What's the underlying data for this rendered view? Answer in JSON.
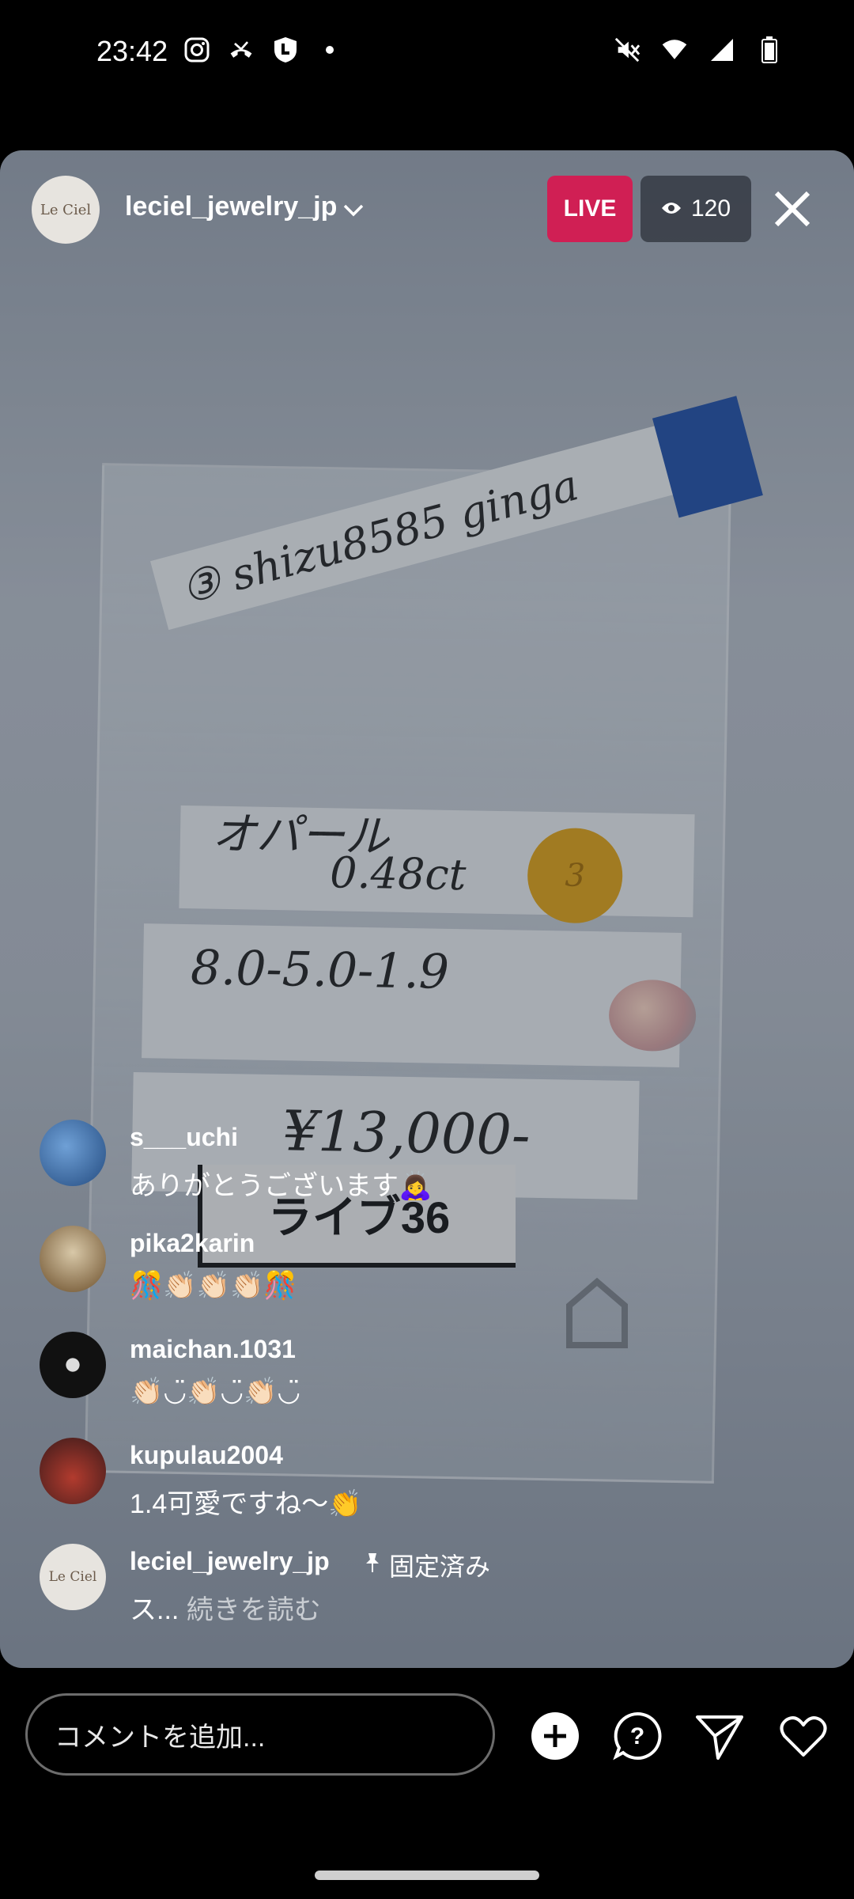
{
  "status_bar": {
    "time": "23:42",
    "left_icons": [
      "instagram-icon",
      "missed-call-icon",
      "shield-lock-icon",
      "dot-icon"
    ],
    "right_icons": [
      "mute-icon",
      "wifi-icon",
      "signal-icon",
      "battery-icon"
    ]
  },
  "live": {
    "host_name": "leciel_jewelry_jp",
    "host_avatar_text": "Le Ciel",
    "live_badge": "LIVE",
    "viewer_count": "120"
  },
  "scene": {
    "tag_text": "③ shizu8585 ginga",
    "label1_text": "オパール",
    "label1_ct": "0.48ct",
    "label1_badge": "3",
    "label2_text": "8.0-5.0-1.9",
    "price_text": "¥13,000-",
    "live_label": "ライブ36"
  },
  "comments": [
    {
      "user": "s___uchi",
      "text": "ありがとうございます🙇‍♀️",
      "avatar_color": "#3b6aa8"
    },
    {
      "user": "pika2karin",
      "text": "🎊👏🏻👏🏻👏🏻🎊",
      "avatar_color": "#8a6a45"
    },
    {
      "user": "maichan.1031",
      "text": "👏🏻◡̈👏🏻◡̈👏🏻◡̈",
      "avatar_color": "#1a1a1a"
    },
    {
      "user": "kupulau2004",
      "text": "1.4可愛ですね〜👏",
      "avatar_color": "#5a2a2a"
    }
  ],
  "pinned_comment": {
    "user": "leciel_jewelry_jp",
    "pin_label": "固定済み",
    "text_prefix": "ス...",
    "more_label": "続きを読む"
  },
  "bottom_bar": {
    "input_placeholder": "コメントを追加...",
    "icons": [
      "add-icon",
      "question-icon",
      "send-icon",
      "heart-icon"
    ]
  }
}
